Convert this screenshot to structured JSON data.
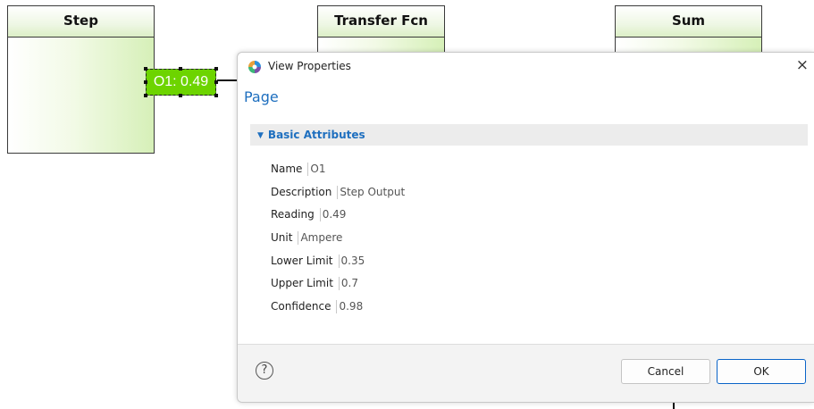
{
  "canvas": {
    "blocks": [
      {
        "id": "step",
        "title": "Step"
      },
      {
        "id": "transfer_fcn",
        "title": "Transfer Fcn"
      },
      {
        "id": "sum",
        "title": "Sum"
      }
    ],
    "port_tag": "O1: 0.49",
    "colors": {
      "tag_fill": "#6dd400",
      "block_gradient_end": "#d6f0b8"
    }
  },
  "dialog": {
    "title": "View Properties",
    "page_title": "Page",
    "section": {
      "label": "Basic Attributes",
      "expanded": true,
      "properties": [
        {
          "label": "Name",
          "value": "O1"
        },
        {
          "label": "Description",
          "value": "Step Output"
        },
        {
          "label": "Reading",
          "value": "0.49"
        },
        {
          "label": "Unit",
          "value": "Ampere"
        },
        {
          "label": "Lower Limit",
          "value": "0.35"
        },
        {
          "label": "Upper Limit",
          "value": "0.7"
        },
        {
          "label": "Confidence",
          "value": "0.98"
        }
      ]
    },
    "help_glyph": "?",
    "close_glyph": "×",
    "buttons": {
      "cancel": "Cancel",
      "ok": "OK"
    },
    "colors": {
      "accent": "#1e6fbf",
      "ok_border": "#0a64c8"
    }
  }
}
